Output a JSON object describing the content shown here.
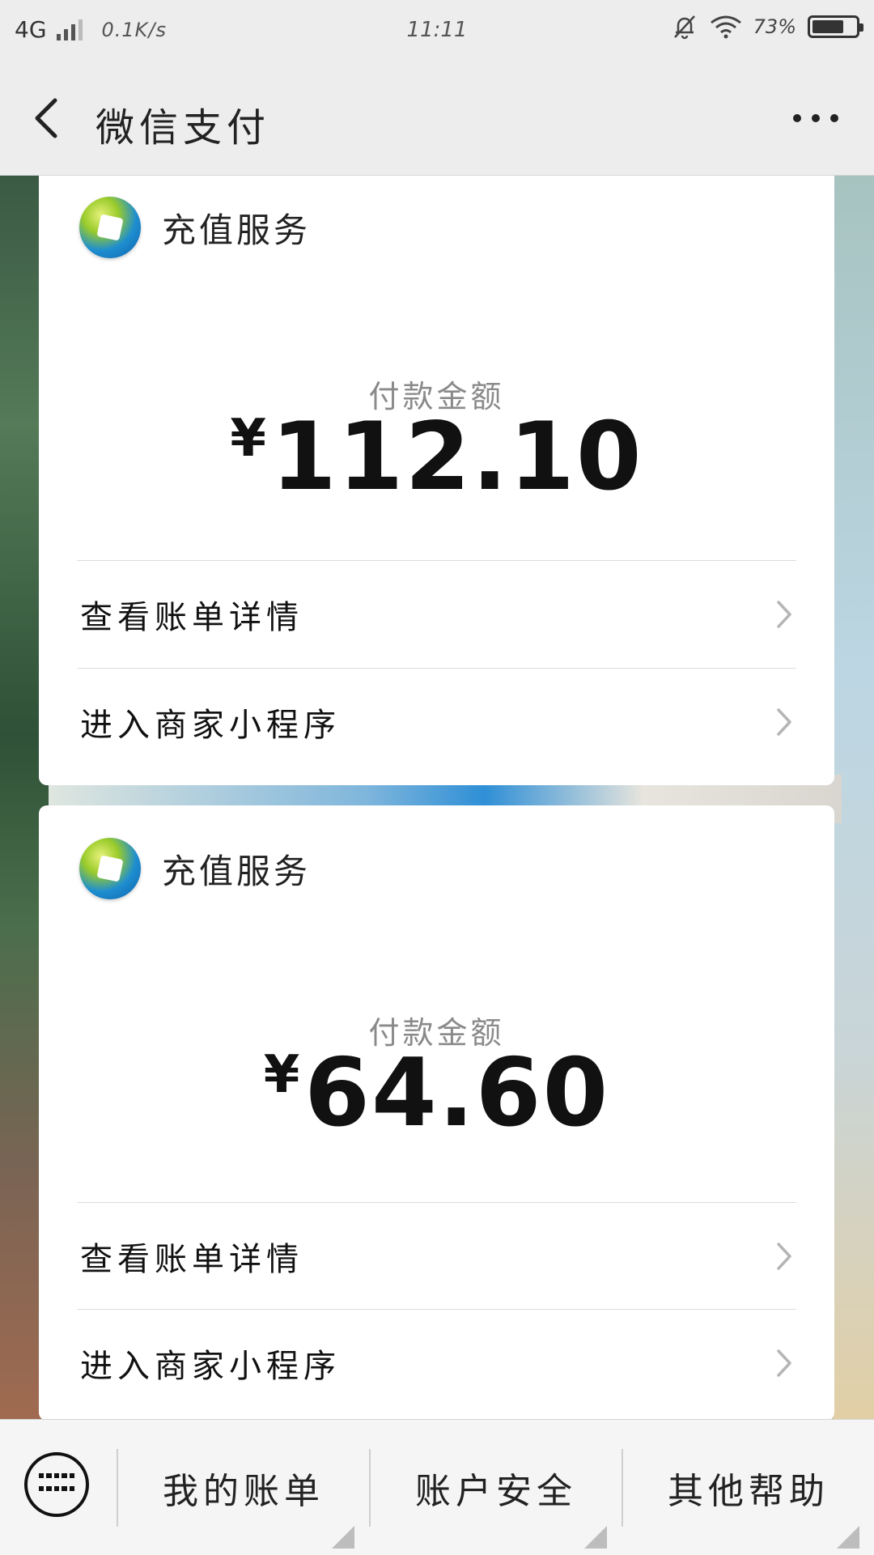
{
  "status_bar": {
    "network": "4G",
    "speed": "0.1K/s",
    "time": "11:11",
    "battery_percent": "73%",
    "battery_level": 0.73
  },
  "nav": {
    "title": "微信支付"
  },
  "cards": [
    {
      "merchant": "充值服务",
      "amount_label": "付款金额",
      "currency": "¥",
      "amount": "112.10",
      "rows": [
        "查看账单详情",
        "进入商家小程序"
      ]
    },
    {
      "merchant": "充值服务",
      "amount_label": "付款金额",
      "currency": "¥",
      "amount": "64.60",
      "rows": [
        "查看账单详情",
        "进入商家小程序"
      ]
    }
  ],
  "bottom_bar": {
    "tabs": [
      "我的账单",
      "账户安全",
      "其他帮助"
    ]
  },
  "icons": {
    "back": "chevron-left-icon",
    "more": "more-dots-icon",
    "keyboard": "keyboard-icon",
    "row_arrow": "chevron-right-icon",
    "mute": "bell-off-icon",
    "wifi": "wifi-icon"
  }
}
